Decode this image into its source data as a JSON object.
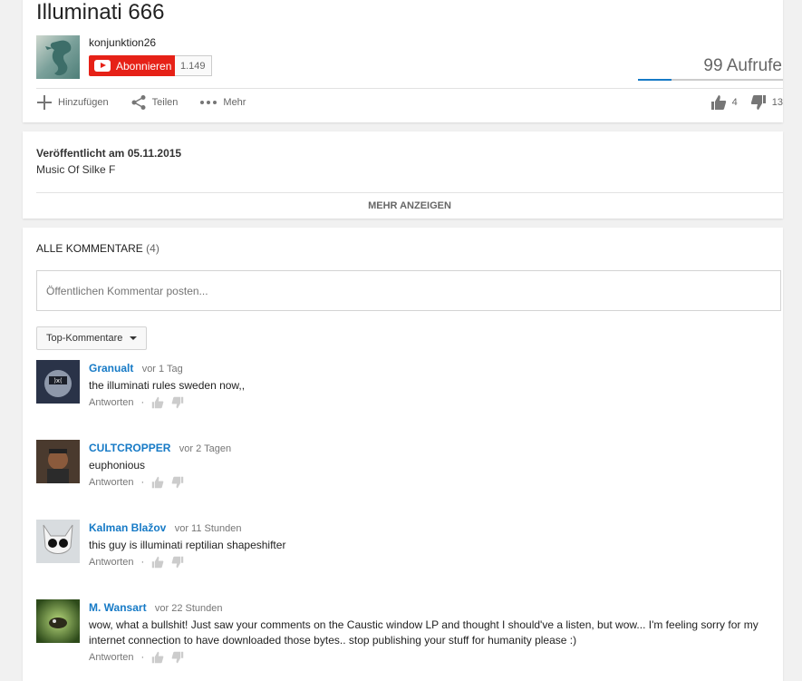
{
  "video": {
    "title": "Illuminati 666",
    "channel": "konjunktion26",
    "subscribe_label": "Abonnieren",
    "subscriber_count": "1.149",
    "views": "99 Aufrufe",
    "view_progress": 0.23,
    "actions": {
      "add": "Hinzufügen",
      "share": "Teilen",
      "more": "Mehr"
    },
    "likes": "4",
    "dislikes": "13"
  },
  "description": {
    "published": "Veröffentlicht am 05.11.2015",
    "text": "Music Of Silke F",
    "show_more": "MEHR ANZEIGEN"
  },
  "comments_section": {
    "header": "ALLE KOMMENTARE",
    "count": "(4)",
    "input_placeholder": "Öffentlichen Kommentar posten...",
    "sort_label": "Top-Kommentare",
    "reply_label": "Antworten",
    "items": [
      {
        "author": "Granualt",
        "time": "vor 1 Tag",
        "text": "the illuminati rules sweden now,,"
      },
      {
        "author": "CULTCROPPER",
        "time": "vor 2 Tagen",
        "text": "euphonious"
      },
      {
        "author": "Kalman Blažov",
        "time": "vor 11 Stunden",
        "text": "this guy is illuminati reptilian shapeshifter"
      },
      {
        "author": "M. Wansart",
        "time": "vor 22 Stunden",
        "text": "wow, what a bullshit! Just saw your comments on the Caustic window LP and thought I should've a listen, but wow... I'm feeling sorry for my internet connection to have downloaded those bytes.. stop publishing your stuff for humanity please :)"
      }
    ]
  },
  "colors": {
    "brand_red": "#e62117",
    "link_blue": "#167ac6"
  }
}
